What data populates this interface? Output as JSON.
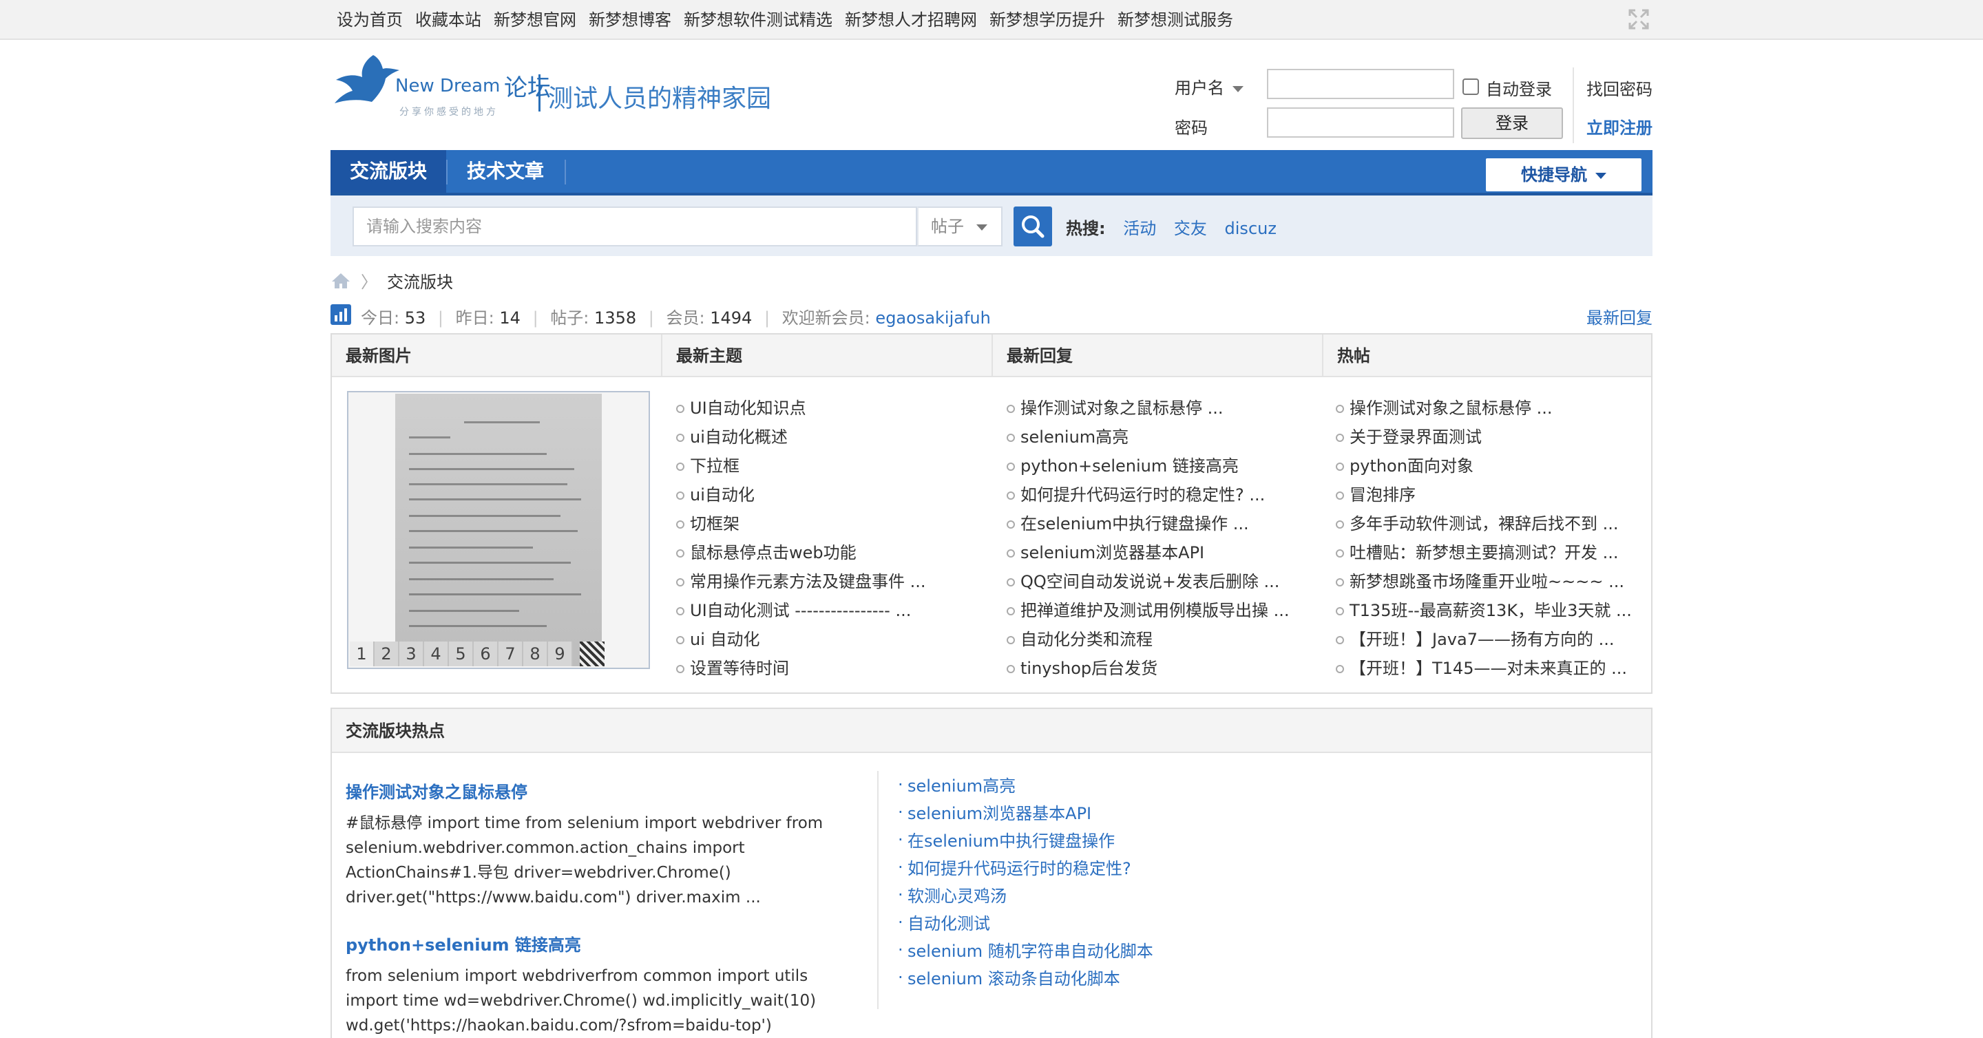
{
  "topbar": {
    "links": [
      "设为首页",
      "收藏本站",
      "新梦想官网",
      "新梦想博客",
      "新梦想软件测试精选",
      "新梦想人才招聘网",
      "新梦想学历提升",
      "新梦想测试服务"
    ],
    "fullscreen_icon": "fullscreen-icon"
  },
  "logo": {
    "brand_en": "New Dream",
    "brand_cn": "论坛",
    "tagline_small": "分享你感受的地方",
    "slogan": "测试人员的精神家园"
  },
  "login": {
    "username_label": "用户名",
    "password_label": "密码",
    "username_value": "",
    "password_value": "",
    "auto_login_label": "自动登录",
    "auto_login_checked": false,
    "login_button": "登录",
    "forgot_password": "找回密码",
    "register": "立即注册"
  },
  "nav": {
    "tabs": [
      {
        "label": "交流版块",
        "active": true
      },
      {
        "label": "技术文章",
        "active": false
      }
    ],
    "quick_nav": "快捷导航",
    "colors": {
      "bar": "#2b6fc0",
      "active": "#1d55a3"
    }
  },
  "search": {
    "placeholder": "请输入搜索内容",
    "type_value": "帖子",
    "hot_label": "热搜:",
    "hot_terms": [
      "活动",
      "交友",
      "discuz"
    ]
  },
  "breadcrumb": {
    "home_icon": "home-icon",
    "current": "交流版块"
  },
  "stats": {
    "today_label": "今日:",
    "today": "53",
    "yesterday_label": "昨日:",
    "yesterday": "14",
    "posts_label": "帖子:",
    "posts": "1358",
    "members_label": "会员:",
    "members": "1494",
    "welcome_label": "欢迎新会员:",
    "new_member": "egaosakijafuh",
    "latest_reply_link": "最新回复"
  },
  "panel": {
    "headers": [
      "最新图片",
      "最新主题",
      "最新回复",
      "热帖"
    ],
    "slide_pages": [
      "1",
      "2",
      "3",
      "4",
      "5",
      "6",
      "7",
      "8",
      "9"
    ],
    "latest_topics": [
      "UI自动化知识点",
      "ui自动化概述",
      "下拉框",
      "ui自动化",
      "切框架",
      "鼠标悬停点击web功能",
      "常用操作元素方法及键盘事件 ...",
      "UI自动化测试 ---------------- ...",
      "ui 自动化",
      "设置等待时间"
    ],
    "latest_replies": [
      "操作测试对象之鼠标悬停 ...",
      "selenium高亮",
      "python+selenium 链接高亮",
      "如何提升代码运行时的稳定性? ...",
      "在selenium中执行键盘操作 ...",
      "selenium浏览器基本API",
      "QQ空间自动发说说+发表后删除 ...",
      "把禅道维护及测试用例模版导出操 ...",
      "自动化分类和流程",
      "tinyshop后台发货"
    ],
    "hot_posts": [
      "操作测试对象之鼠标悬停 ...",
      "关于登录界面测试",
      "python面向对象",
      "冒泡排序",
      "多年手动软件测试，裸辞后找不到 ...",
      "吐槽贴：新梦想主要搞测试？开发 ...",
      "新梦想跳蚤市场隆重开业啦~~~~ ...",
      "T135班--最高薪资13K，毕业3天就 ...",
      "【开班！】Java7——扬有方向的 ...",
      "【开班！】T145——对未来真正的 ..."
    ]
  },
  "hot_section": {
    "title": "交流版块热点",
    "articles": [
      {
        "title": "操作测试对象之鼠标悬停",
        "body": "#鼠标悬停 import time from selenium import webdriver from selenium.webdriver.common.action_chains import ActionChains#1.导包 driver=webdriver.Chrome() driver.get(\"https://www.baidu.com\") driver.maxim ..."
      },
      {
        "title": "python+selenium 链接高亮",
        "body": "from selenium import webdriverfrom common import utils import time wd=webdriver.Chrome() wd.implicitly_wait(10) wd.get('https://haokan.baidu.com/?sfrom=baidu-top')"
      }
    ],
    "links": [
      "selenium高亮",
      "selenium浏览器基本API",
      "在selenium中执行键盘操作",
      "如何提升代码运行时的稳定性?",
      "软测心灵鸡汤",
      "自动化测试",
      "selenium 随机字符串自动化脚本",
      "selenium 滚动条自动化脚本"
    ]
  }
}
